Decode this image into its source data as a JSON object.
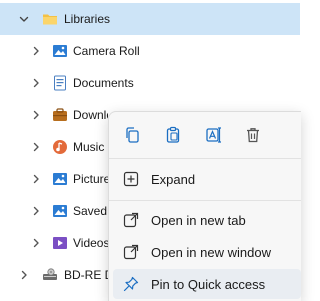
{
  "tree": {
    "items": [
      {
        "label": "Libraries",
        "icon": "folder-icon",
        "expanded": true
      },
      {
        "label": "Camera Roll",
        "icon": "pictures-library-icon"
      },
      {
        "label": "Documents",
        "icon": "documents-library-icon"
      },
      {
        "label": "Downloads",
        "icon": "downloads-library-icon"
      },
      {
        "label": "Music",
        "icon": "music-library-icon"
      },
      {
        "label": "Pictures",
        "icon": "pictures-library-icon"
      },
      {
        "label": "Saved Pictures",
        "icon": "pictures-library-icon"
      },
      {
        "label": "Videos",
        "icon": "videos-library-icon"
      },
      {
        "label": "BD-RE Drive",
        "icon": "optical-drive-icon"
      }
    ]
  },
  "context_menu": {
    "quick_actions": [
      {
        "name": "copy",
        "icon": "copy-icon"
      },
      {
        "name": "paste",
        "icon": "paste-icon"
      },
      {
        "name": "rename",
        "icon": "rename-icon"
      },
      {
        "name": "delete",
        "icon": "delete-icon"
      }
    ],
    "items": [
      {
        "label": "Expand",
        "icon": "expand-icon"
      },
      {
        "label": "Open in new tab",
        "icon": "open-new-tab-icon"
      },
      {
        "label": "Open in new window",
        "icon": "open-new-window-icon"
      },
      {
        "label": "Pin to Quick access",
        "icon": "pin-icon"
      }
    ]
  },
  "colors": {
    "selected_row": "#cde4f7",
    "accent": "#1b6ec2",
    "menu_bg": "#f7f7f7",
    "menu_hover": "#e9edf2"
  }
}
